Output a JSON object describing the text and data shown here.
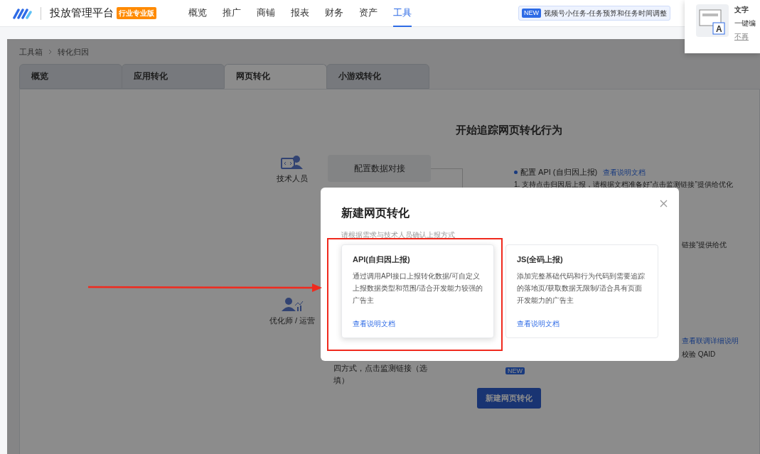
{
  "header": {
    "title": "投放管理平台",
    "edition_badge": "行业专业版",
    "nav": [
      {
        "label": "概览",
        "selected": false
      },
      {
        "label": "推广",
        "selected": false
      },
      {
        "label": "商铺",
        "selected": false
      },
      {
        "label": "报表",
        "selected": false
      },
      {
        "label": "财务",
        "selected": false
      },
      {
        "label": "资产",
        "selected": false
      },
      {
        "label": "工具",
        "selected": true
      }
    ],
    "notice": {
      "badge": "NEW",
      "text": "视频号小任务-任务预算和任务时间调整"
    }
  },
  "tip_popup": {
    "title": "文字",
    "icon_letter": "A",
    "text": "一键编",
    "link": "不再"
  },
  "breadcrumb": [
    "工具箱",
    "转化归因"
  ],
  "tabs": [
    {
      "label": "概览",
      "selected": false
    },
    {
      "label": "应用转化",
      "selected": false
    },
    {
      "label": "网页转化",
      "selected": true
    },
    {
      "label": "小游戏转化",
      "selected": false
    }
  ],
  "page": {
    "heading": "开始追踪网页转化行为",
    "roles": [
      {
        "kind": "tech",
        "label": "技术人员"
      },
      {
        "kind": "ops",
        "label": "优化师 / 运营"
      }
    ],
    "config_button": "配置数据对接",
    "api_bullet": {
      "text": "配置 API (自归因上报)",
      "link": "查看说明文档"
    },
    "api_step": "1. 支持点击归因后上报，请根据文档准备好“点击监测链接”提供给优化",
    "right_fragment": "链接”提供给优",
    "debug_link": "查看联调详细说明",
    "qaid_text": "校验 QAID",
    "left_fragment_lines": [
      "四方式，点击监测链接（选",
      "填）"
    ],
    "new_badge": "NEW",
    "create_button": "新建网页转化"
  },
  "modal": {
    "title": "新建网页转化",
    "subtitle": "请根据需求与技术人员确认上报方式",
    "options": [
      {
        "title": "API(自归因上报)",
        "description": "通过调用API接口上报转化数据/可自定义上报数据类型和范围/适合开发能力较强的广告主",
        "link": "查看说明文档",
        "selected": true
      },
      {
        "title": "JS(全码上报)",
        "description": "添加完整基础代码和行为代码到需要追踪的落地页/获取数据无限制/适合具有页面开发能力的广告主",
        "link": "查看说明文档",
        "selected": false
      }
    ]
  },
  "annotations": {
    "highlight_box": true,
    "arrow": true
  }
}
